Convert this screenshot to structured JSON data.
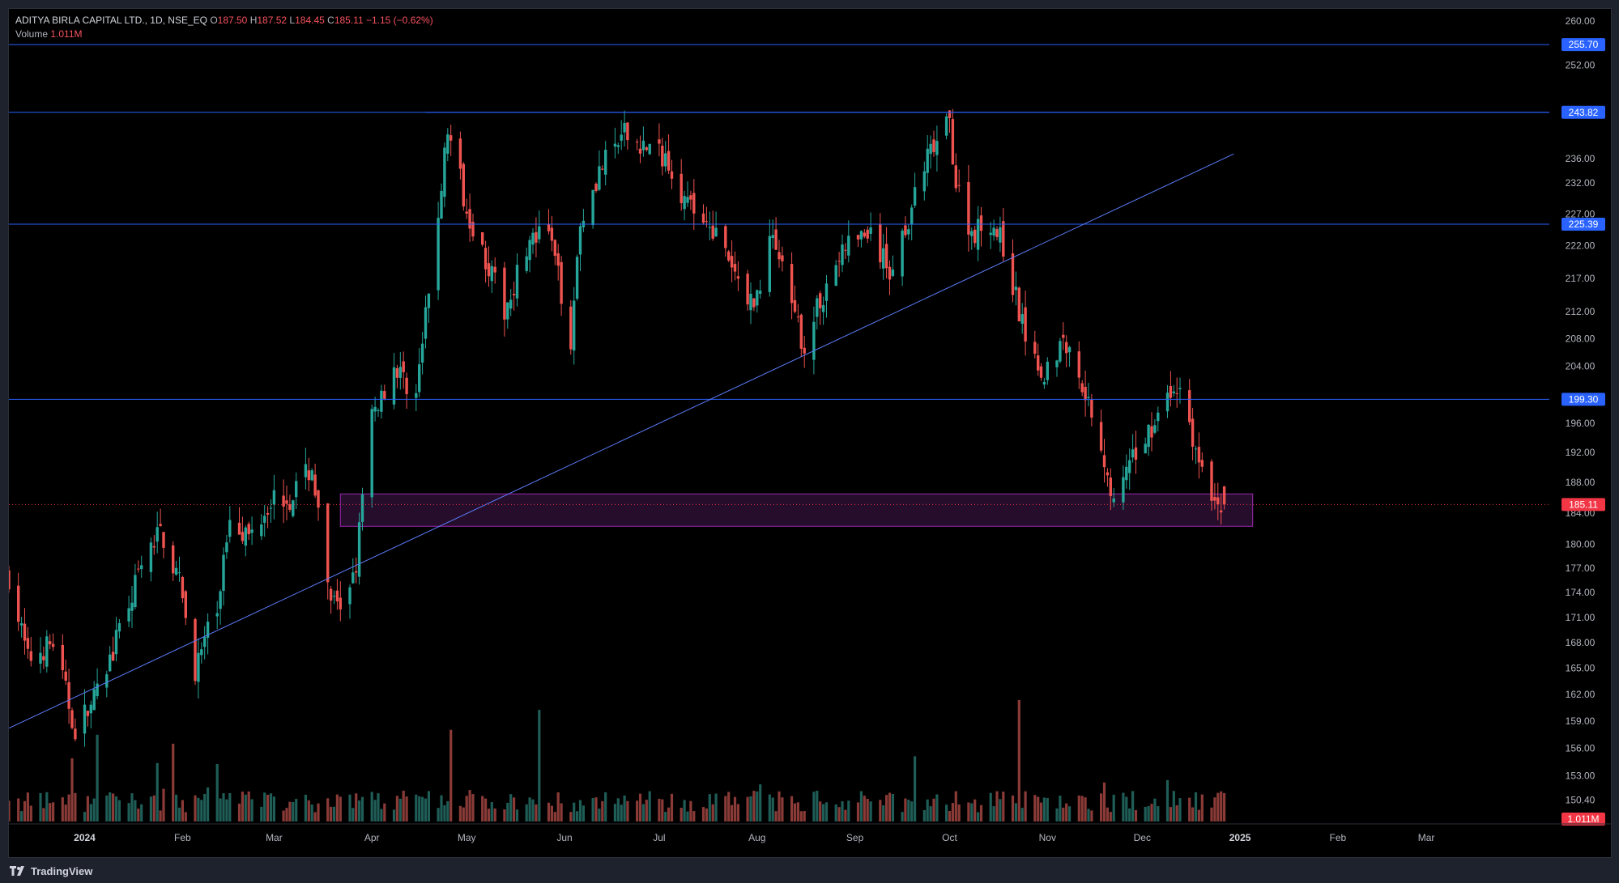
{
  "legend": {
    "symbol": "ADITYA BIRLA CAPITAL LTD., 1D, NSE_EQ",
    "open_label": "O",
    "open": "187.50",
    "high_label": "H",
    "high": "187.52",
    "low_label": "L",
    "low": "184.45",
    "close_label": "C",
    "close": "185.11",
    "change": "−1.15 (−0.62%)",
    "volume_label": "Volume",
    "volume": "1.011M"
  },
  "brand": {
    "name": "TradingView"
  },
  "colors": {
    "background": "#000000",
    "up": "#26a69a",
    "down": "#ef5350",
    "line": "#2962ff",
    "zone_border": "#9c27b0",
    "zone_fill": "#3b1442",
    "price_tag": "#2962ff",
    "last_price_tag": "#f23645"
  },
  "chart_data": {
    "type": "candlestick",
    "title": "ADITYA BIRLA CAPITAL LTD., 1D, NSE_EQ",
    "x_axis": {
      "labels": [
        "2024",
        "Feb",
        "Mar",
        "Apr",
        "May",
        "Jun",
        "Jul",
        "Aug",
        "Sep",
        "Oct",
        "Nov",
        "Dec",
        "2025",
        "Feb",
        "Mar"
      ],
      "bold_labels": [
        "2024",
        "2025"
      ],
      "range": [
        "2023-12-08",
        "2025-03-31"
      ]
    },
    "y_axis": {
      "scale": "log",
      "range": [
        148.5,
        261
      ],
      "ticks": [
        "260.00",
        "252.00",
        "236.00",
        "232.00",
        "227.00",
        "222.00",
        "217.00",
        "212.00",
        "208.00",
        "204.00",
        "196.00",
        "192.00",
        "188.00",
        "184.00",
        "180.00",
        "177.00",
        "174.00",
        "171.00",
        "168.00",
        "165.00",
        "162.00",
        "159.00",
        "156.00",
        "153.00",
        "150.40"
      ]
    },
    "horizontal_levels": [
      "255.70",
      "243.82",
      "225.39",
      "199.30"
    ],
    "last_price": "185.11",
    "last_volume": "1.011M",
    "trendline": {
      "from": [
        "2023-12-08",
        158.2
      ],
      "to": [
        "2024-12-30",
        236.8
      ]
    },
    "resistance_segment": {
      "from": "2024-04-18",
      "to": "2025-01-07",
      "price": 243.82
    },
    "demand_zone": {
      "from": "2024-03-22",
      "to": "2025-01-05",
      "low": 182.3,
      "high": 186.5
    },
    "price_path": [
      [
        "2023-12-08",
        176
      ],
      [
        "2023-12-14",
        166
      ],
      [
        "2023-12-22",
        168
      ],
      [
        "2023-12-29",
        158
      ],
      [
        "2024-01-05",
        162
      ],
      [
        "2024-01-11",
        168
      ],
      [
        "2024-01-18",
        176
      ],
      [
        "2024-01-25",
        182
      ],
      [
        "2024-01-31",
        175
      ],
      [
        "2024-02-05",
        165
      ],
      [
        "2024-02-12",
        172
      ],
      [
        "2024-02-16",
        184
      ],
      [
        "2024-02-22",
        181
      ],
      [
        "2024-02-29",
        186
      ],
      [
        "2024-03-06",
        186
      ],
      [
        "2024-03-13",
        190
      ],
      [
        "2024-03-18",
        174
      ],
      [
        "2024-03-22",
        171
      ],
      [
        "2024-03-27",
        178
      ],
      [
        "2024-04-01",
        197
      ],
      [
        "2024-04-08",
        204
      ],
      [
        "2024-04-15",
        200
      ],
      [
        "2024-04-20",
        218
      ],
      [
        "2024-04-25",
        241
      ],
      [
        "2024-05-01",
        228
      ],
      [
        "2024-05-07",
        220
      ],
      [
        "2024-05-13",
        212
      ],
      [
        "2024-05-20",
        222
      ],
      [
        "2024-05-27",
        224
      ],
      [
        "2024-06-03",
        208
      ],
      [
        "2024-06-06",
        226
      ],
      [
        "2024-06-12",
        234
      ],
      [
        "2024-06-20",
        240
      ],
      [
        "2024-06-27",
        238
      ],
      [
        "2024-07-04",
        236
      ],
      [
        "2024-07-10",
        228
      ],
      [
        "2024-07-17",
        226
      ],
      [
        "2024-07-24",
        218
      ],
      [
        "2024-07-31",
        213
      ],
      [
        "2024-08-06",
        224
      ],
      [
        "2024-08-12",
        212
      ],
      [
        "2024-08-16",
        207
      ],
      [
        "2024-08-23",
        216
      ],
      [
        "2024-08-29",
        222
      ],
      [
        "2024-09-05",
        224
      ],
      [
        "2024-09-12",
        218
      ],
      [
        "2024-09-19",
        228
      ],
      [
        "2024-09-24",
        236
      ],
      [
        "2024-10-01",
        242
      ],
      [
        "2024-10-03",
        232
      ],
      [
        "2024-10-08",
        224
      ],
      [
        "2024-10-14",
        226
      ],
      [
        "2024-10-18",
        222
      ],
      [
        "2024-10-24",
        210
      ],
      [
        "2024-10-31",
        203
      ],
      [
        "2024-11-06",
        208
      ],
      [
        "2024-11-12",
        202
      ],
      [
        "2024-11-18",
        193
      ],
      [
        "2024-11-22",
        185
      ],
      [
        "2024-11-27",
        190
      ],
      [
        "2024-12-03",
        195
      ],
      [
        "2024-12-09",
        199
      ],
      [
        "2024-12-13",
        201
      ],
      [
        "2024-12-17",
        194
      ],
      [
        "2024-12-20",
        189
      ],
      [
        "2024-12-23",
        186
      ],
      [
        "2024-12-27",
        185.11
      ]
    ],
    "volume_shape": "mostly low volume with spikes in late March, late April, late September and early November 2024"
  }
}
